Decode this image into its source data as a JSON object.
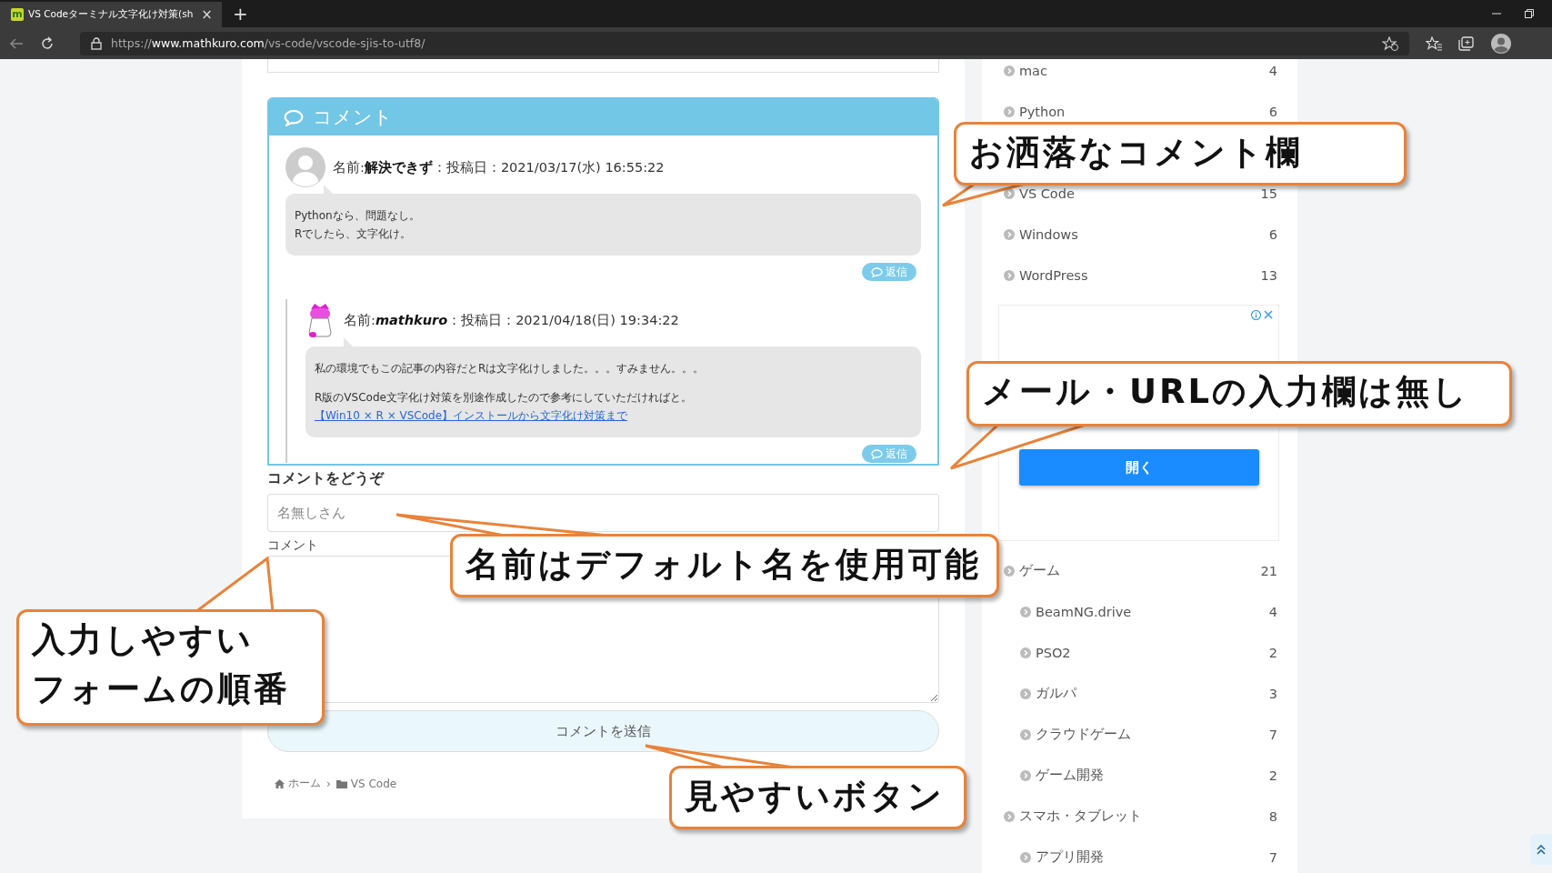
{
  "browser": {
    "tab": {
      "favicon": "m",
      "title": "VS Codeターミナル文字化け対策(sh",
      "close": "×"
    },
    "new_tab": "+",
    "url": "https://**www.mathkuro.com**/vs-code/vscode-sjis-to-utf8/"
  },
  "comments": {
    "title": "コメント",
    "items": [
      {
        "kind": "default",
        "meta": "名前:**解決できず**：投稿日：2021/03/17(水) 16:55:22",
        "paragraphs": [
          {
            "text": "Pythonなら、問題なし。\nRでしたら、文字化け。"
          }
        ],
        "reply": "返信",
        "children": [
          {
            "kind": "character",
            "meta": "名前:*mathkuro*：投稿日：2021/04/18(日) 19:34:22",
            "paragraphs": [
              {
                "text": "私の環境でもこの記事の内容だとRは文字化けしました。。。すみません。。。"
              },
              {
                "text": "R版のVSCode文字化け対策を別途作成したので参考にしていただければと。"
              }
            ],
            "link": "【Win10 × R × VSCode】インストールから文字化け対策まで",
            "reply": "返信"
          }
        ]
      }
    ]
  },
  "form": {
    "heading": "コメントをどうぞ",
    "name_placeholder": "名無しさん",
    "comment_label": "コメント",
    "submit": "コメントを送信"
  },
  "breadcrumb": {
    "separator": "›",
    "items": [
      {
        "kind": "home",
        "label": "ホーム"
      },
      {
        "kind": "folder",
        "label": "VS Code"
      }
    ]
  },
  "sidebar": {
    "categories_top": [
      {
        "label": "mac",
        "count": "4"
      },
      {
        "label": "Python",
        "count": "6"
      },
      {
        "label": "VS Code",
        "count": "15"
      },
      {
        "label": "Windows",
        "count": "6"
      },
      {
        "label": "WordPress",
        "count": "13"
      }
    ],
    "ad": {
      "button": "開く"
    },
    "categories_bottom": [
      {
        "label": "ゲーム",
        "count": "21",
        "children": [
          {
            "label": "BeamNG.drive",
            "count": "4"
          },
          {
            "label": "PSO2",
            "count": "2"
          },
          {
            "label": "ガルパ",
            "count": "3"
          },
          {
            "label": "クラウドゲーム",
            "count": "7"
          },
          {
            "label": "ゲーム開発",
            "count": "2"
          }
        ]
      },
      {
        "label": "スマホ・タブレット",
        "count": "8",
        "children": [
          {
            "label": "アプリ開発",
            "count": "7"
          }
        ]
      }
    ]
  },
  "callouts": [
    {
      "lines": [
        "お洒落なコメント欄"
      ]
    },
    {
      "lines": [
        "メール・URLの入力欄は無し"
      ]
    },
    {
      "lines": [
        "名前はデフォルト名を使用可能"
      ]
    },
    {
      "lines": [
        "入力しやすい",
        "フォームの順番"
      ]
    },
    {
      "lines": [
        "見やすいボタン"
      ]
    }
  ]
}
